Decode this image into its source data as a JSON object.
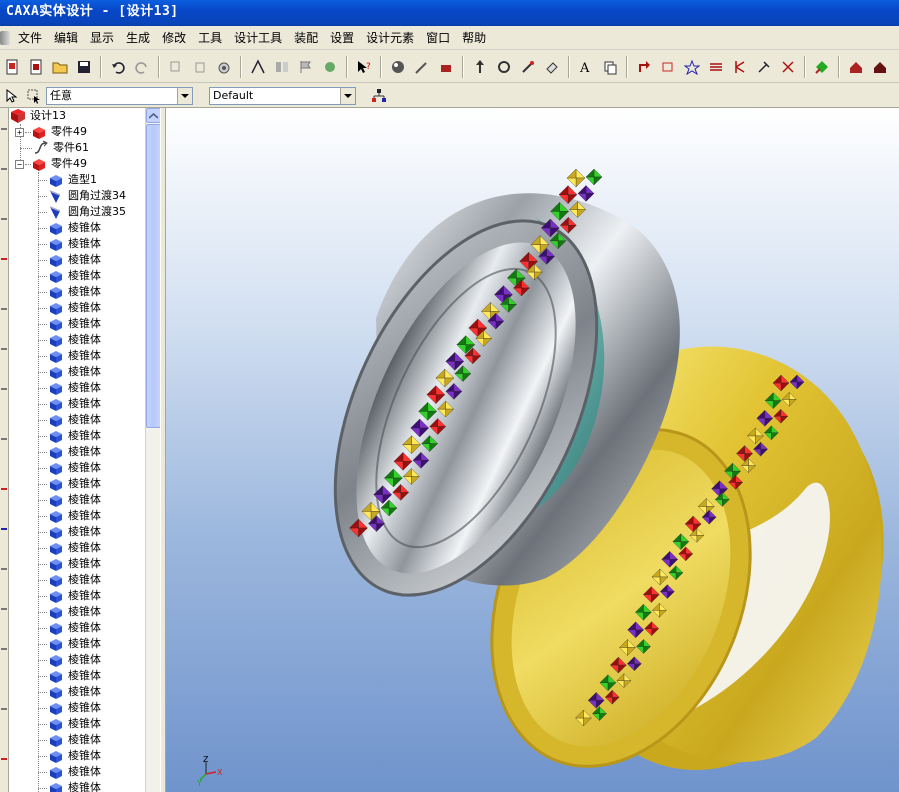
{
  "window": {
    "title": "CAXA实体设计 - [设计13]"
  },
  "menu": [
    "文件",
    "编辑",
    "显示",
    "生成",
    "修改",
    "工具",
    "设计工具",
    "装配",
    "设置",
    "设计元素",
    "窗口",
    "帮助"
  ],
  "selectors": {
    "filter_value": "任意",
    "style_value": "Default"
  },
  "tree": {
    "root": "设计13",
    "part_a": "零件49",
    "part_b": "零件61",
    "part_c": "零件49",
    "features": [
      "造型1",
      "圆角过渡34",
      "圆角过渡35"
    ],
    "pyramid_label": "棱锥体",
    "pyramid_count": 36
  },
  "axes": {
    "x": "X",
    "y": "Y",
    "z": "Z"
  },
  "colors": {
    "titlebar": "#0a5fe0",
    "silver": "#c8ccd0",
    "gold": "#e6cf3c",
    "teal": "#3f8f88"
  }
}
